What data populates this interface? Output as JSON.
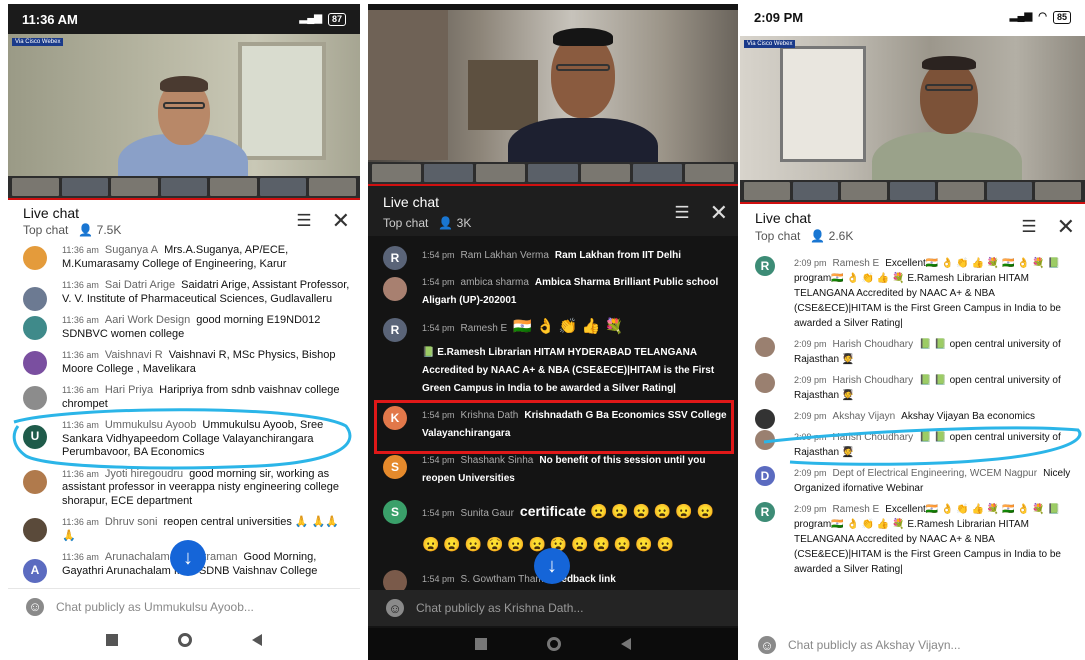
{
  "panels": [
    {
      "status_time": "11:36 AM",
      "status_battery": "87",
      "watermark": "Via Cisco Webex",
      "live_chat_title": "Live chat",
      "chat_mode": "Top chat",
      "viewers": "7.5K",
      "input_placeholder": "Chat publicly as Ummukulsu Ayoob...",
      "messages": [
        {
          "time": "11:36 am",
          "author": "Suganya A",
          "text": "Mrs.A.Suganya, AP/ECE, M.Kumarasamy College of Engineering, Karur"
        },
        {
          "time": "11:36 am",
          "author": "Sai Datri Arige",
          "text": "Saidatri Arige, Assistant Professor, V. V. Institute of Pharmaceutical Sciences, Gudlavalleru"
        },
        {
          "time": "11:36 am",
          "author": "Aari Work Design",
          "text": "good morning E19ND012 SDNBVC women college"
        },
        {
          "time": "11:36 am",
          "author": "Vaishnavi R",
          "text": "Vaishnavi R, MSc Physics, Bishop Moore College , Mavelikara"
        },
        {
          "time": "11:36 am",
          "author": "Hari Priya",
          "text": "Haripriya from sdnb vaishnav college chrompet"
        },
        {
          "time": "11:36 am",
          "author": "Ummukulsu Ayoob",
          "text": "Ummukulsu Ayoob, Sree Sankara Vidhyapeedom Collage Valayanchirangara Perumbavoor, BA Economics",
          "avatar_letter": "U"
        },
        {
          "time": "11:36 am",
          "author": "Jyoti hiregoudru",
          "text": "good morning sir, working as assistant professor in veerappa nisty engineering college shorapur, ECE department"
        },
        {
          "time": "11:36 am",
          "author": "Dhruv soni",
          "text": "reopen central universities 🙏 🙏🙏🙏"
        },
        {
          "time": "11:36 am",
          "author": "Arunachalam Venkatraman",
          "text": "Good Morning, Gayathri Arunachalam from SDNB Vaishnav College",
          "avatar_letter": "A"
        }
      ]
    },
    {
      "live_chat_title": "Live chat",
      "chat_mode": "Top chat",
      "viewers": "3K",
      "input_placeholder": "Chat publicly as Krishna Dath...",
      "messages": [
        {
          "time": "1:54 pm",
          "author": "Ram Lakhan Verma",
          "text": "Ram Lakhan from IIT Delhi",
          "avatar_letter": "R"
        },
        {
          "time": "1:54 pm",
          "author": "ambica sharma",
          "text": "Ambica Sharma Brilliant Public school Aligarh (UP)-202001"
        },
        {
          "time": "1:54 pm",
          "author": "Ramesh E",
          "text": "🇮🇳 👌 👏 👍 💐",
          "avatar_letter": "R"
        },
        {
          "time": "",
          "author": "",
          "text": "📗 E.Ramesh Librarian HITAM HYDERABAD TELANGANA Accredited by NAAC A+ & NBA (CSE&ECE)|HITAM is the First Green Campus in India to be awarded a Silver Rating|"
        },
        {
          "time": "1:54 pm",
          "author": "Krishna Dath",
          "text": "Krishnadath G Ba Economics SSV College Valayanchirangara",
          "avatar_letter": "K"
        },
        {
          "time": "1:54 pm",
          "author": "Shashank Sinha",
          "text": "No benefit of this session until you reopen Universities",
          "avatar_letter": "S"
        },
        {
          "time": "1:54 pm",
          "author": "Sunita Gaur",
          "text": "certificate 😦 😦 😦 😦 😦 😦 😦 😦 😦 😧 😦 😦 😧 😦 😦 😦 😦 😦",
          "avatar_letter": "S"
        },
        {
          "time": "1:54 pm",
          "author": "S. Gowtham Tham",
          "text": "Feedback link"
        }
      ]
    },
    {
      "status_time": "2:09 PM",
      "status_battery": "85",
      "watermark": "Via Cisco Webex",
      "live_chat_title": "Live chat",
      "chat_mode": "Top chat",
      "viewers": "2.6K",
      "input_placeholder": "Chat publicly as Akshay Vijayn...",
      "messages": [
        {
          "time": "2:09 pm",
          "author": "Ramesh E",
          "text": "Excellent🇮🇳 👌 👏 👍 💐 🇮🇳 👌 💐 📗 program🇮🇳 👌 👏 👍 💐 E.Ramesh Librarian HITAM TELANGANA Accredited by NAAC A+ & NBA (CSE&ECE)|HITAM is the First Green Campus in India to be awarded a Silver Rating|",
          "avatar_letter": "R"
        },
        {
          "time": "2:09 pm",
          "author": "Harish Choudhary",
          "text": "📗 📗 open central university of Rajasthan 🧑‍🎓"
        },
        {
          "time": "2:09 pm",
          "author": "Harish Choudhary",
          "text": "📗 📗 open central university of Rajasthan 🧑‍🎓"
        },
        {
          "time": "2:09 pm",
          "author": "Akshay Vijayn",
          "text": "Akshay Vijayan Ba economics"
        },
        {
          "time": "2:09 pm",
          "author": "Harish Choudhary",
          "text": "📗 📗 open central university of Rajasthan 🧑‍🎓"
        },
        {
          "time": "2:09 pm",
          "author": "Dept of Electrical Engineering, WCEM Nagpur",
          "text": "Nicely Organized ifornative Webinar",
          "avatar_letter": "D"
        },
        {
          "time": "2:09 pm",
          "author": "Ramesh E",
          "text": "Excellent🇮🇳 👌 👏 👍 💐 🇮🇳 👌 💐 📗 program🇮🇳 👌 👏 👍 💐 E.Ramesh Librarian HITAM TELANGANA Accredited by NAAC A+ & NBA (CSE&ECE)|HITAM is the First Green Campus in India to be awarded a Silver Rating|",
          "avatar_letter": "R"
        }
      ]
    }
  ],
  "icons": {
    "viewers": "person-icon",
    "filter": "tune-icon",
    "close": "close-icon",
    "emoji": "smiley-icon",
    "scroll": "arrow-down-icon"
  },
  "colors": {
    "highlight_circle": "#2bb5e8",
    "red_box": "#e01818",
    "fab": "#1565d8"
  }
}
